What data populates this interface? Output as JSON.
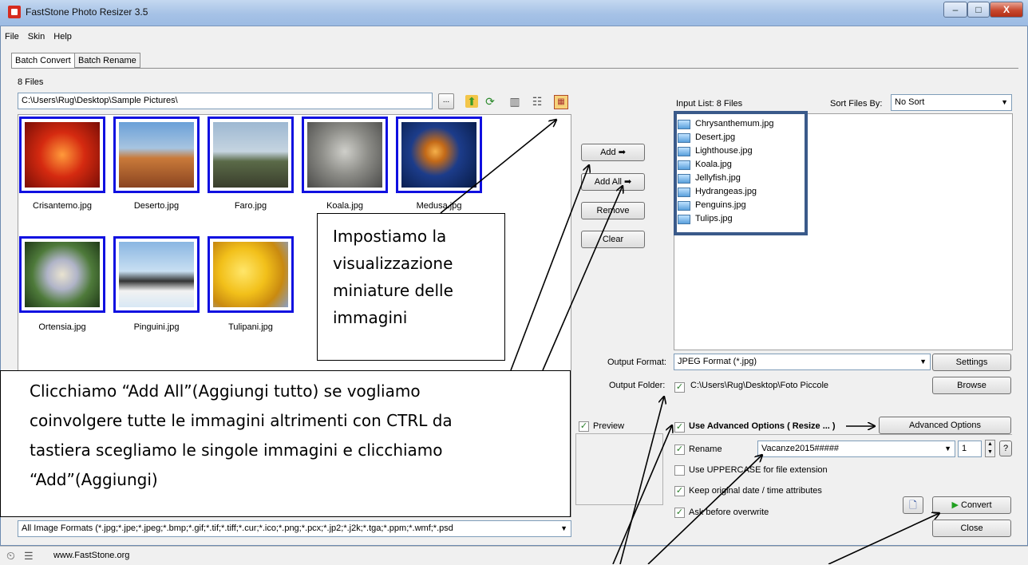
{
  "window": {
    "title": "FastStone Photo Resizer 3.5",
    "min": "–",
    "max": "□",
    "close": "X"
  },
  "menu": [
    "File",
    "Skin",
    "Help"
  ],
  "tabs": [
    "Batch Convert",
    "Batch Rename"
  ],
  "files_count": "8 Files",
  "path": "C:\\Users\\Rug\\Desktop\\Sample Pictures\\",
  "browse_dots": "...",
  "thumbnails": [
    {
      "caption": "Crisantemo.jpg",
      "color": "#d52a10"
    },
    {
      "caption": "Deserto.jpg",
      "color": "#b86a2e"
    },
    {
      "caption": "Faro.jpg",
      "color": "#7a9fbf"
    },
    {
      "caption": "Koala.jpg",
      "color": "#9a9a96"
    },
    {
      "caption": "Medusa.jpg",
      "color": "#1c3c8a"
    },
    {
      "caption": "Ortensia.jpg",
      "color": "#5f8a4a"
    },
    {
      "caption": "Pinguini.jpg",
      "color": "#6c9fd0"
    },
    {
      "caption": "Tulipani.jpg",
      "color": "#e8c51a"
    }
  ],
  "buttons": {
    "add": "Add ➡",
    "add_all": "Add All ➡",
    "remove": "Remove",
    "clear": "Clear"
  },
  "input_list": {
    "label": "Input List:  8 Files",
    "sort_label": "Sort Files By:",
    "sort_value": "No Sort",
    "items": [
      "Chrysanthemum.jpg",
      "Desert.jpg",
      "Lighthouse.jpg",
      "Koala.jpg",
      "Jellyfish.jpg",
      "Hydrangeas.jpg",
      "Penguins.jpg",
      "Tulips.jpg"
    ]
  },
  "output": {
    "format_label": "Output Format:",
    "format_value": "JPEG Format (*.jpg)",
    "settings": "Settings",
    "folder_label": "Output Folder:",
    "folder_value": "C:\\Users\\Rug\\Desktop\\Foto Piccole",
    "browse": "Browse"
  },
  "preview_label": "Preview",
  "options": {
    "advanced": "Use Advanced Options ( Resize ... )",
    "advanced_btn": "Advanced Options",
    "rename": "Rename",
    "rename_value": "Vacanze2015#####",
    "rename_start": "1",
    "help": "?",
    "uppercase": "Use UPPERCASE for file extension",
    "keep_date": "Keep original date / time attributes",
    "ask_overwrite": "Ask before overwrite"
  },
  "convert": "Convert",
  "close": "Close",
  "file_filter": "All Image Formats (*.jpg;*.jpe;*.jpeg;*.bmp;*.gif;*.tif;*.tiff;*.cur;*.ico;*.png;*.pcx;*.jp2;*.j2k;*.tga;*.ppm;*.wmf;*.psd",
  "status_url": "www.FastStone.org",
  "callouts": {
    "thumbnails": [
      "Impostiamo la",
      "visualizzazione",
      "miniature delle",
      "immagini"
    ],
    "add_all": [
      "Clicchiamo “Add All”(Aggiungi tutto) se vogliamo",
      "coinvolgere tutte le immagini altrimenti con CTRL da",
      "tastiera scegliamo le singole immagini e clicchiamo",
      "“Add”(Aggiungi)"
    ]
  }
}
